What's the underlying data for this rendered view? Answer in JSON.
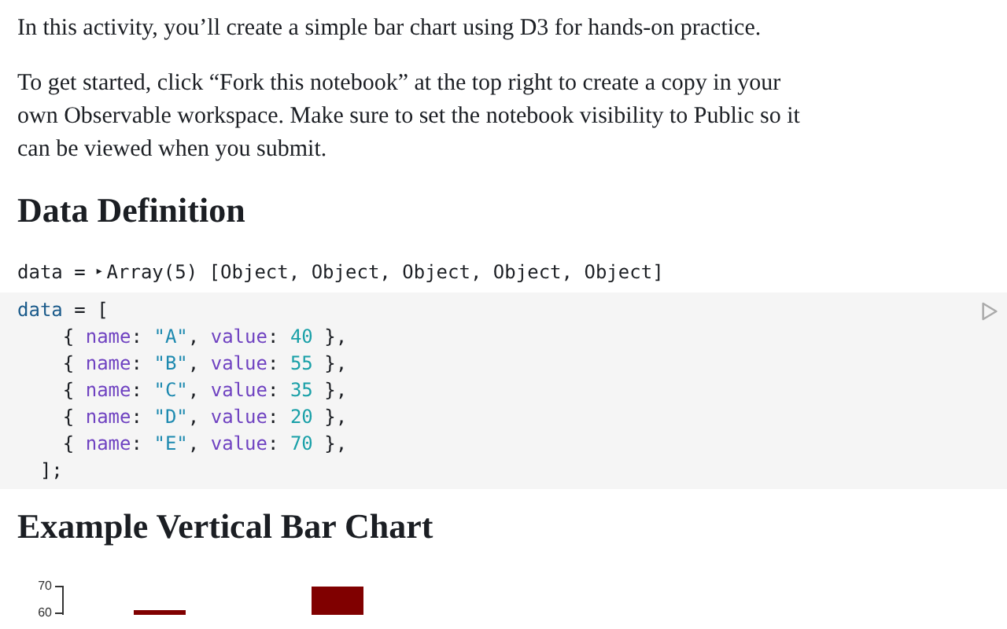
{
  "intro": "In this activity, you’ll create a simple bar chart using D3 for hands-on practice.",
  "instructions": "To get started, click “Fork this notebook” at the top right to create a copy in your own Observable workspace. Make sure to set the notebook visibility to Public so it can be viewed when you submit.",
  "section_heading": "Data Definition",
  "output": {
    "name": "data =",
    "toggle": "▸",
    "summary": "Array(5) [Object, Object, Object, Object, Object]"
  },
  "code_lines": [
    [
      {
        "kind": "var",
        "text": "data"
      },
      {
        "kind": "plain",
        "text": " = ["
      }
    ],
    [
      {
        "kind": "plain",
        "text": "    { "
      },
      {
        "kind": "key",
        "text": "name"
      },
      {
        "kind": "plain",
        "text": ": "
      },
      {
        "kind": "string",
        "text": "\"A\""
      },
      {
        "kind": "plain",
        "text": ", "
      },
      {
        "kind": "key",
        "text": "value"
      },
      {
        "kind": "plain",
        "text": ": "
      },
      {
        "kind": "number",
        "text": "40"
      },
      {
        "kind": "plain",
        "text": " },"
      }
    ],
    [
      {
        "kind": "plain",
        "text": "    { "
      },
      {
        "kind": "key",
        "text": "name"
      },
      {
        "kind": "plain",
        "text": ": "
      },
      {
        "kind": "string",
        "text": "\"B\""
      },
      {
        "kind": "plain",
        "text": ", "
      },
      {
        "kind": "key",
        "text": "value"
      },
      {
        "kind": "plain",
        "text": ": "
      },
      {
        "kind": "number",
        "text": "55"
      },
      {
        "kind": "plain",
        "text": " },"
      }
    ],
    [
      {
        "kind": "plain",
        "text": "    { "
      },
      {
        "kind": "key",
        "text": "name"
      },
      {
        "kind": "plain",
        "text": ": "
      },
      {
        "kind": "string",
        "text": "\"C\""
      },
      {
        "kind": "plain",
        "text": ", "
      },
      {
        "kind": "key",
        "text": "value"
      },
      {
        "kind": "plain",
        "text": ": "
      },
      {
        "kind": "number",
        "text": "35"
      },
      {
        "kind": "plain",
        "text": " },"
      }
    ],
    [
      {
        "kind": "plain",
        "text": "    { "
      },
      {
        "kind": "key",
        "text": "name"
      },
      {
        "kind": "plain",
        "text": ": "
      },
      {
        "kind": "string",
        "text": "\"D\""
      },
      {
        "kind": "plain",
        "text": ", "
      },
      {
        "kind": "key",
        "text": "value"
      },
      {
        "kind": "plain",
        "text": ": "
      },
      {
        "kind": "number",
        "text": "20"
      },
      {
        "kind": "plain",
        "text": " },"
      }
    ],
    [
      {
        "kind": "plain",
        "text": "    { "
      },
      {
        "kind": "key",
        "text": "name"
      },
      {
        "kind": "plain",
        "text": ": "
      },
      {
        "kind": "string",
        "text": "\"E\""
      },
      {
        "kind": "plain",
        "text": ", "
      },
      {
        "kind": "key",
        "text": "value"
      },
      {
        "kind": "plain",
        "text": ": "
      },
      {
        "kind": "number",
        "text": "70"
      },
      {
        "kind": "plain",
        "text": " },"
      }
    ],
    [
      {
        "kind": "plain",
        "text": "  ];"
      }
    ]
  ],
  "chart_heading": "Example Vertical Bar Chart",
  "chart": {
    "y_axis_labels": [
      "70",
      "60"
    ]
  }
}
